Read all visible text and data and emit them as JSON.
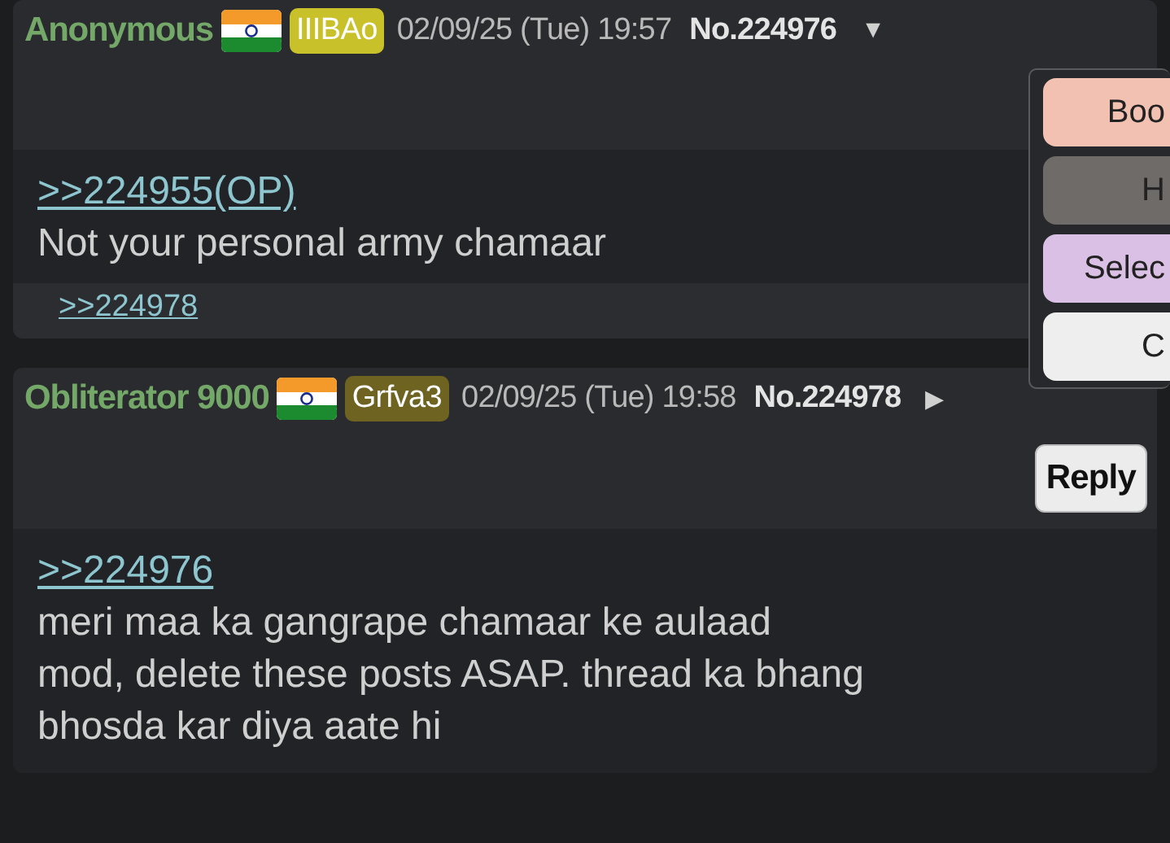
{
  "posts": [
    {
      "name": "Anonymous",
      "id_tag": {
        "text": "IIIBAo",
        "color": "#c9c12a"
      },
      "date": "02/09/25 (Tue) 19:57",
      "number": "No.224976",
      "menu_toggle": "▼",
      "quote": ">>224955(OP)",
      "body": [
        "Not your personal army chamaar"
      ],
      "backlinks": [
        ">>224978"
      ]
    },
    {
      "name": "Obliterator 9000",
      "id_tag": {
        "text": "Grfva3",
        "color": "#6e6320"
      },
      "date": "02/09/25 (Tue) 19:58",
      "number": "No.224978",
      "menu_toggle": "▶",
      "reply_button": "Reply",
      "quote": ">>224976",
      "body": [
        "meri maa ka gangrape chamaar ke aulaad",
        "mod, delete these posts ASAP. thread ka bhang",
        "bhosda kar diya aate hi"
      ]
    }
  ],
  "context_menu": {
    "items": [
      {
        "label": "Boo",
        "color": "#f2c1b1"
      },
      {
        "label": "H",
        "color": "#6f6b69"
      },
      {
        "label": "Selec",
        "color": "#d9c0e4"
      },
      {
        "label": "C",
        "color": "#eeeeee"
      }
    ]
  }
}
